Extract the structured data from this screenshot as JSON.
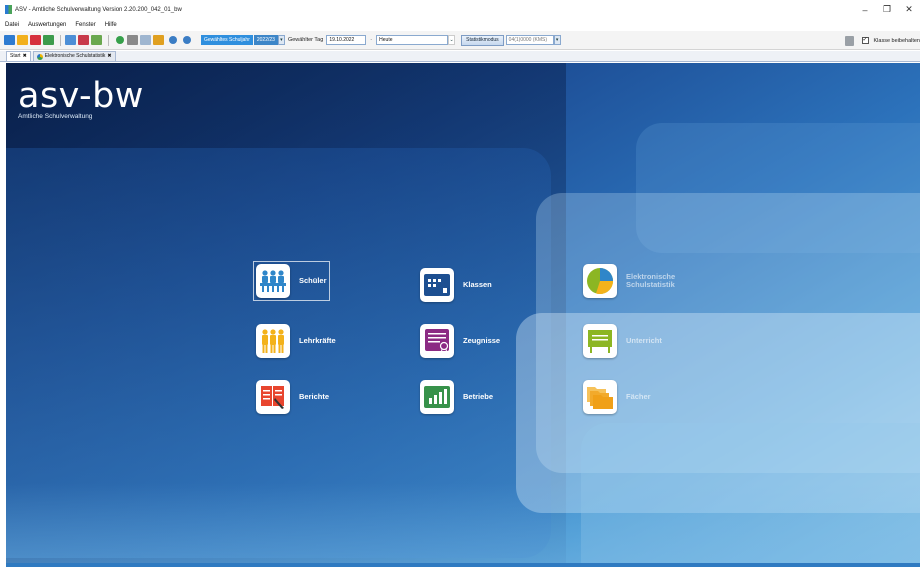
{
  "window": {
    "title": "ASV - Amtliche Schulverwaltung Version 2.20.200_042_01_bw",
    "controls": [
      "–",
      "❐",
      "✕"
    ]
  },
  "menu": [
    "Datei",
    "Auswertungen",
    "Fenster",
    "Hilfe"
  ],
  "toolbar": {
    "schoolyear_label": "Gewähltes Schuljahr",
    "schoolyear_value": "2022/23",
    "day_label": "Gewählter Tag",
    "day_value": "19.10.2022",
    "day_preset": "Heute",
    "stat_button": "Statistikmodus",
    "stat_value": "04(1)0000 (KMS)",
    "keep_class_label": "Klasse beibehalten"
  },
  "tabs": [
    {
      "label": "Start"
    },
    {
      "label": "Elektronische Schulstatistik"
    }
  ],
  "brand": {
    "name": "asv-bw",
    "subtitle": "Amtliche Schulverwaltung"
  },
  "modules": {
    "schueler": "Schüler",
    "lehrkraefte": "Lehrkräfte",
    "berichte": "Berichte",
    "klassen": "Klassen",
    "zeugnisse": "Zeugnisse",
    "betriebe": "Betriebe",
    "statistik": "Elektronische Schulstatistik",
    "unterricht": "Unterricht",
    "faecher": "Fächer"
  },
  "colors": {
    "schueler": "#2f86c9",
    "lehrkraefte": "#f3b21b",
    "berichte": "#e8452e",
    "klassen": "#1d4f91",
    "zeugnisse": "#8b2a83",
    "betriebe": "#37924a",
    "unterricht": "#8cb623",
    "faecher": "#f0a018"
  }
}
